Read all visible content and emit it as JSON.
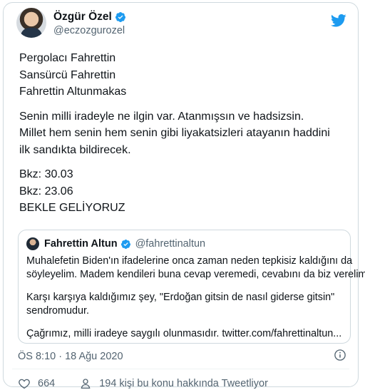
{
  "tweet": {
    "author_name": "Özgür Özel",
    "author_handle": "@eczozgurozel",
    "lines_group1": [
      "Pergolacı Fahrettin",
      "Sansürcü Fahrettin",
      "Fahrettin Altunmakas"
    ],
    "lines_group2": [
      "Senin milli iradeyle ne ilgin var. Atanmışsın ve hadsizsin.",
      "Millet hem senin hem senin gibi liyakatsizleri atayanın haddini",
      "ilk sandıkta bildirecek."
    ],
    "lines_group3": [
      "Bkz: 30.03",
      "Bkz: 23.06",
      "BEKLE GELİYORUZ"
    ],
    "quoted": {
      "author_name": "Fahrettin Altun",
      "author_handle": "@fahrettinaltun",
      "para1": [
        "Muhalefetin Biden'ın ifadelerine onca zaman neden tepkisiz kaldığını da",
        "söyleyelim. Madem kendileri buna cevap veremedi, cevabını da biz verelim:"
      ],
      "para2": [
        "Karşı karşıya kaldığımız şey, \"Erdoğan gitsin de nasıl giderse gitsin\"",
        "sendromudur."
      ],
      "para3": [
        "Çağrımız, milli iradeye saygılı olunmasıdır. twitter.com/fahrettinaltun..."
      ]
    },
    "timestamp": "ÖS 8:10 · 18 Ağu 2020",
    "like_count": "664",
    "people_talking": "194 kişi bu konu hakkında Tweetliyor"
  },
  "colors": {
    "accent": "#1d9bf0",
    "text": "#0f1419",
    "secondary_text": "#536471",
    "border": "#cfd9de"
  },
  "icons": {
    "verified": "verified-badge-icon",
    "brand": "twitter-bird-icon",
    "info": "info-icon",
    "like": "heart-icon",
    "people": "person-icon"
  }
}
